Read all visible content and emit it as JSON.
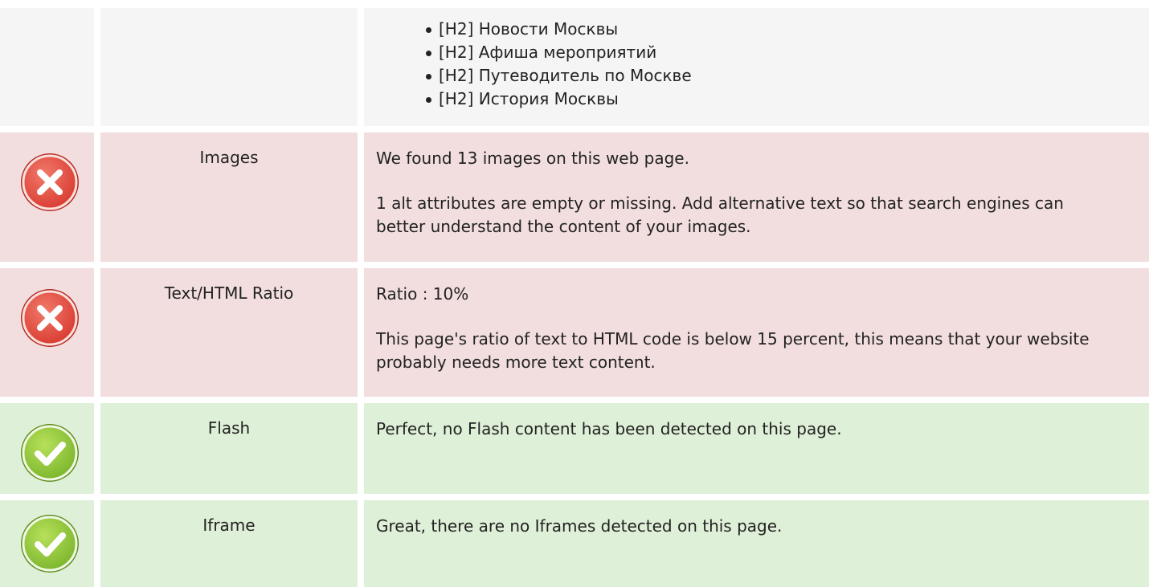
{
  "headings_row": {
    "items": [
      "[H2] Новости Москвы",
      "[H2] Афиша мероприятий",
      "[H2] Путеводитель по Москве",
      "[H2] История Москвы"
    ]
  },
  "rows": [
    {
      "status": "error",
      "label": "Images",
      "paragraphs": [
        "We found 13 images on this web page.",
        "1 alt attributes are empty or missing. Add alternative text so that search engines can better understand the content of your images."
      ]
    },
    {
      "status": "error",
      "label": "Text/HTML Ratio",
      "paragraphs": [
        "Ratio : 10%",
        "This page's ratio of text to HTML code is below 15 percent, this means that your website probably needs more text content."
      ]
    },
    {
      "status": "ok",
      "label": "Flash",
      "paragraphs": [
        "Perfect, no Flash content has been detected on this page."
      ]
    },
    {
      "status": "ok",
      "label": "Iframe",
      "paragraphs": [
        "Great, there are no Iframes detected on this page."
      ]
    }
  ],
  "icons": {
    "error": "error-x-icon",
    "ok": "success-check-icon"
  },
  "colors": {
    "error_bg": "#f2dede",
    "ok_bg": "#dff0d8",
    "neutral_bg": "#f5f5f5",
    "error_icon": "#e0403a",
    "ok_icon": "#8cc63f"
  }
}
